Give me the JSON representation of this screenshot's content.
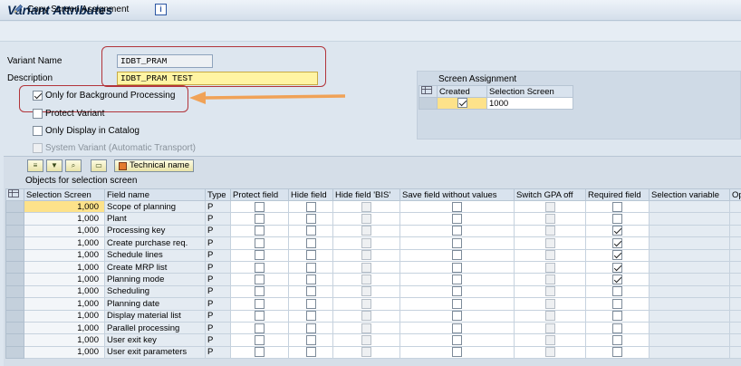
{
  "window": {
    "title": "Variant Attributes"
  },
  "toolbar": {
    "copy_label": "Copy Screen Assignment",
    "info_icon": "i"
  },
  "form": {
    "variant_name_label": "Variant Name",
    "variant_name_value": "IDBT_PRAM",
    "description_label": "Description",
    "description_value": "IDBT_PRAM TEST"
  },
  "options": [
    {
      "label": "Only for Background Processing",
      "checked": true,
      "disabled": false
    },
    {
      "label": "Protect Variant",
      "checked": false,
      "disabled": false
    },
    {
      "label": "Only Display in Catalog",
      "checked": false,
      "disabled": false
    },
    {
      "label": "System Variant (Automatic Transport)",
      "checked": false,
      "disabled": true
    }
  ],
  "screen_assignment": {
    "title": "Screen Assignment",
    "col_created": "Created",
    "col_screen": "Selection Screen",
    "rows": [
      {
        "created": true,
        "screen": "1000"
      }
    ]
  },
  "grid": {
    "tech_name_label": "Technical name",
    "section_title": "Objects for selection screen",
    "columns": [
      "Selection Screen",
      "Field name",
      "Type",
      "Protect field",
      "Hide field",
      "Hide field 'BIS'",
      "Save field without values",
      "Switch GPA off",
      "Required field",
      "Selection variable",
      "Op"
    ],
    "rows": [
      {
        "screen": "1,000",
        "field": "Scope of planning",
        "type": "P",
        "required": false
      },
      {
        "screen": "1,000",
        "field": "Plant",
        "type": "P",
        "required": false
      },
      {
        "screen": "1,000",
        "field": "Processing key",
        "type": "P",
        "required": true
      },
      {
        "screen": "1,000",
        "field": "Create purchase req.",
        "type": "P",
        "required": true
      },
      {
        "screen": "1,000",
        "field": "Schedule lines",
        "type": "P",
        "required": true
      },
      {
        "screen": "1,000",
        "field": "Create MRP list",
        "type": "P",
        "required": true
      },
      {
        "screen": "1,000",
        "field": "Planning mode",
        "type": "P",
        "required": true
      },
      {
        "screen": "1,000",
        "field": "Scheduling",
        "type": "P",
        "required": false
      },
      {
        "screen": "1,000",
        "field": "Planning date",
        "type": "P",
        "required": false
      },
      {
        "screen": "1,000",
        "field": "Display material list",
        "type": "P",
        "required": false
      },
      {
        "screen": "1,000",
        "field": "Parallel processing",
        "type": "P",
        "required": false
      },
      {
        "screen": "1,000",
        "field": "User exit key",
        "type": "P",
        "required": false
      },
      {
        "screen": "1,000",
        "field": "User exit parameters",
        "type": "P",
        "required": false
      }
    ]
  },
  "colors": {
    "annotation_red": "#b2343a",
    "annotation_arrow": "#f0a257",
    "highlight_yellow": "#fde28a"
  }
}
